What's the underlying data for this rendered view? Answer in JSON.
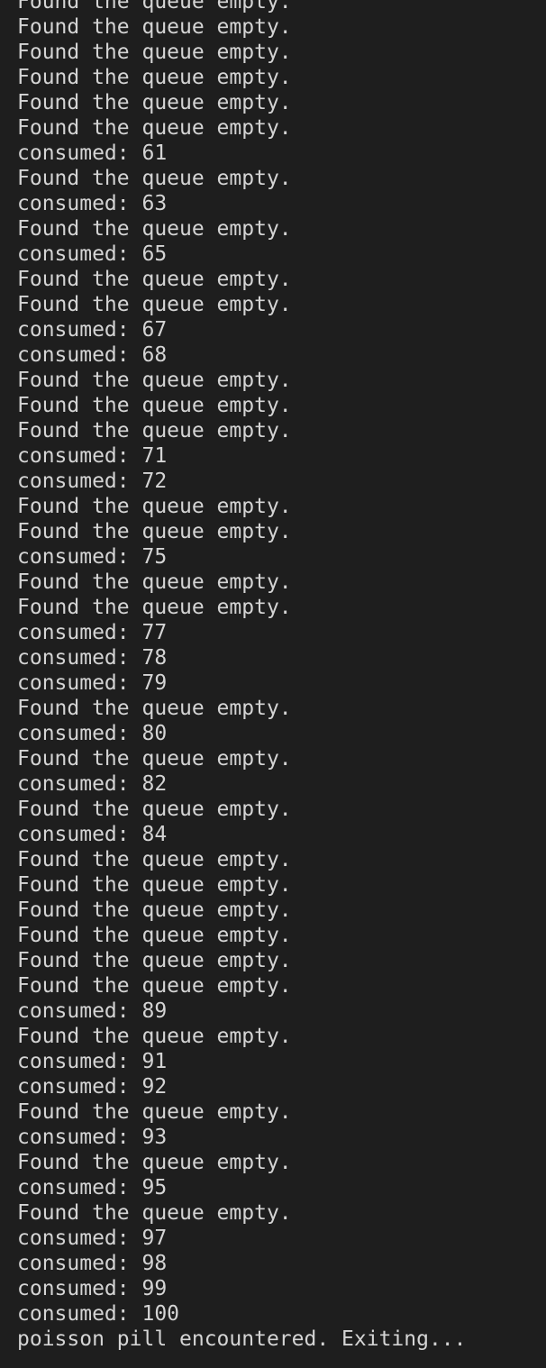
{
  "terminal": {
    "lines": [
      "Found the queue empty.",
      "Found the queue empty.",
      "Found the queue empty.",
      "Found the queue empty.",
      "Found the queue empty.",
      "Found the queue empty.",
      "consumed: 61",
      "Found the queue empty.",
      "consumed: 63",
      "Found the queue empty.",
      "consumed: 65",
      "Found the queue empty.",
      "Found the queue empty.",
      "consumed: 67",
      "consumed: 68",
      "Found the queue empty.",
      "Found the queue empty.",
      "Found the queue empty.",
      "consumed: 71",
      "consumed: 72",
      "Found the queue empty.",
      "Found the queue empty.",
      "consumed: 75",
      "Found the queue empty.",
      "Found the queue empty.",
      "consumed: 77",
      "consumed: 78",
      "consumed: 79",
      "Found the queue empty.",
      "consumed: 80",
      "Found the queue empty.",
      "consumed: 82",
      "Found the queue empty.",
      "consumed: 84",
      "Found the queue empty.",
      "Found the queue empty.",
      "Found the queue empty.",
      "Found the queue empty.",
      "Found the queue empty.",
      "Found the queue empty.",
      "consumed: 89",
      "Found the queue empty.",
      "consumed: 91",
      "consumed: 92",
      "Found the queue empty.",
      "consumed: 93",
      "Found the queue empty.",
      "consumed: 95",
      "Found the queue empty.",
      "consumed: 97",
      "consumed: 98",
      "consumed: 99",
      "consumed: 100",
      "poisson pill encountered. Exiting..."
    ]
  }
}
